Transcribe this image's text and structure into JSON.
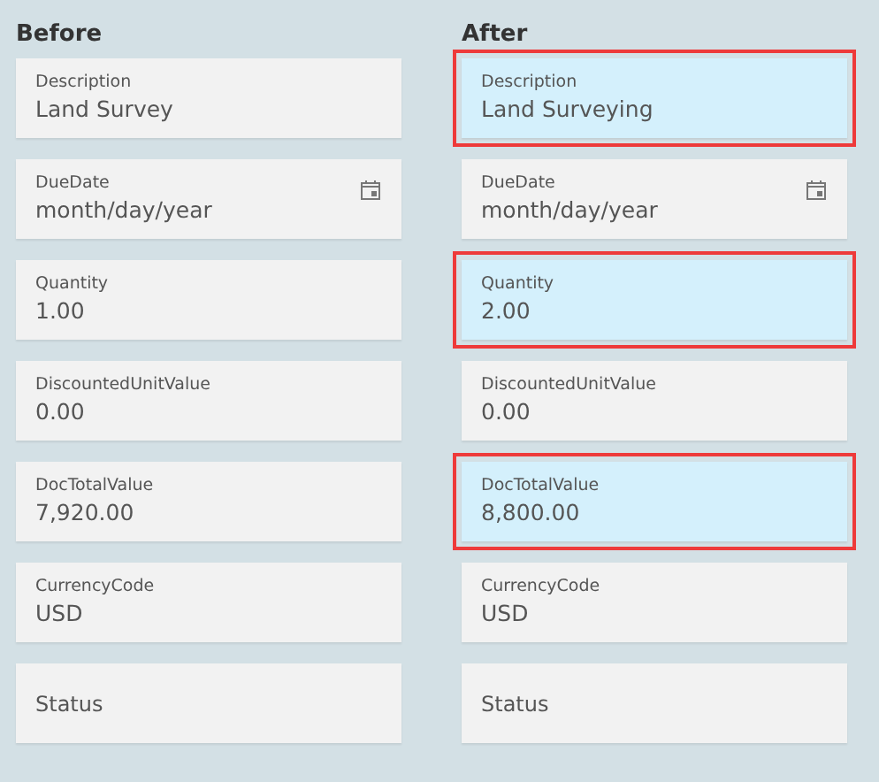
{
  "columns": [
    {
      "title": "Before",
      "fields": [
        {
          "kind": "text",
          "label": "Description",
          "value": "Land Survey",
          "changed": false
        },
        {
          "kind": "date",
          "label": "DueDate",
          "placeholder": "month/day/year",
          "changed": false
        },
        {
          "kind": "text",
          "label": "Quantity",
          "value": "1.00",
          "changed": false
        },
        {
          "kind": "text",
          "label": "DiscountedUnitValue",
          "value": "0.00",
          "changed": false
        },
        {
          "kind": "text",
          "label": "DocTotalValue",
          "value": "7,920.00",
          "changed": false
        },
        {
          "kind": "text",
          "label": "CurrencyCode",
          "value": "USD",
          "changed": false
        },
        {
          "kind": "empty",
          "label": "Status",
          "changed": false
        }
      ]
    },
    {
      "title": "After",
      "fields": [
        {
          "kind": "text",
          "label": "Description",
          "value": "Land Surveying",
          "changed": true
        },
        {
          "kind": "date",
          "label": "DueDate",
          "placeholder": "month/day/year",
          "changed": false
        },
        {
          "kind": "text",
          "label": "Quantity",
          "value": "2.00",
          "changed": true
        },
        {
          "kind": "text",
          "label": "DiscountedUnitValue",
          "value": "0.00",
          "changed": false
        },
        {
          "kind": "text",
          "label": "DocTotalValue",
          "value": "8,800.00",
          "changed": true
        },
        {
          "kind": "text",
          "label": "CurrencyCode",
          "value": "USD",
          "changed": false
        },
        {
          "kind": "empty",
          "label": "Status",
          "changed": false
        }
      ]
    }
  ]
}
